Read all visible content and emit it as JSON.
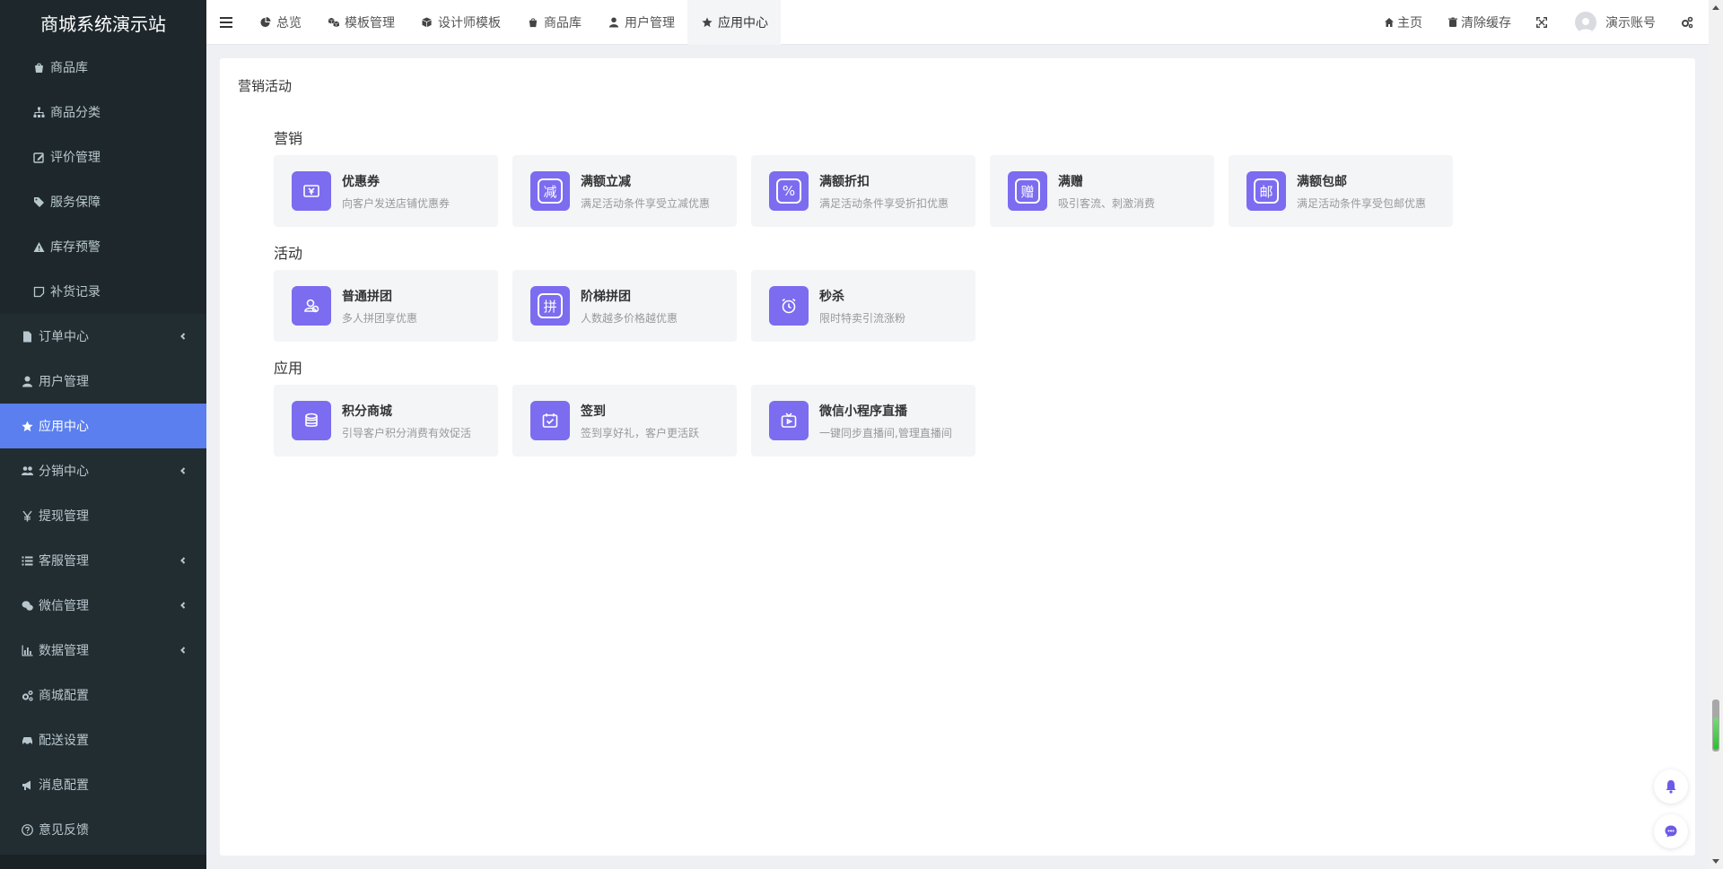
{
  "brand": "商城系统演示站",
  "sidebar": {
    "items": [
      {
        "label": "商品库",
        "icon": "bag-icon",
        "sub": true
      },
      {
        "label": "商品分类",
        "icon": "sitemap-icon",
        "sub": true
      },
      {
        "label": "评价管理",
        "icon": "edit-icon",
        "sub": true
      },
      {
        "label": "服务保障",
        "icon": "tags-icon",
        "sub": true
      },
      {
        "label": "库存预警",
        "icon": "warning-icon",
        "sub": true
      },
      {
        "label": "补货记录",
        "icon": "note-icon",
        "sub": true
      },
      {
        "label": "订单中心",
        "icon": "file-icon",
        "caret": true
      },
      {
        "label": "用户管理",
        "icon": "user-icon"
      },
      {
        "label": "应用中心",
        "icon": "star-icon",
        "active": true
      },
      {
        "label": "分销中心",
        "icon": "users-icon",
        "caret": true
      },
      {
        "label": "提现管理",
        "icon": "yen-icon"
      },
      {
        "label": "客服管理",
        "icon": "list-icon",
        "caret": true
      },
      {
        "label": "微信管理",
        "icon": "wechat-icon",
        "caret": true
      },
      {
        "label": "数据管理",
        "icon": "chart-icon",
        "caret": true
      },
      {
        "label": "商城配置",
        "icon": "cogs-icon"
      },
      {
        "label": "配送设置",
        "icon": "car-icon"
      },
      {
        "label": "消息配置",
        "icon": "bullhorn-icon"
      },
      {
        "label": "意见反馈",
        "icon": "question-icon"
      }
    ]
  },
  "header": {
    "tabs": [
      {
        "label": "总览",
        "icon": "pie-icon"
      },
      {
        "label": "模板管理",
        "icon": "cubes-icon"
      },
      {
        "label": "设计师模板",
        "icon": "cube-icon"
      },
      {
        "label": "商品库",
        "icon": "bag-icon"
      },
      {
        "label": "用户管理",
        "icon": "user-icon"
      },
      {
        "label": "应用中心",
        "icon": "star-icon",
        "active": true
      }
    ],
    "home_label": "主页",
    "clear_cache_label": "清除缓存",
    "account_label": "演示账号"
  },
  "main": {
    "title": "营销活动",
    "sections": [
      {
        "title": "营销",
        "cards": [
          {
            "title": "优惠券",
            "desc": "向客户发送店铺优惠券",
            "icon": "coupon-icon",
            "glyph": ""
          },
          {
            "title": "满额立减",
            "desc": "满足活动条件享受立减优惠",
            "icon": "reduce-icon",
            "glyph": "减"
          },
          {
            "title": "满额折扣",
            "desc": "满足活动条件享受折扣优惠",
            "icon": "percent-icon",
            "glyph": "%"
          },
          {
            "title": "满赠",
            "desc": "吸引客流、刺激消费",
            "icon": "gift-icon",
            "glyph": "赠"
          },
          {
            "title": "满额包邮",
            "desc": "满足活动条件享受包邮优惠",
            "icon": "post-icon",
            "glyph": "邮"
          }
        ]
      },
      {
        "title": "活动",
        "cards": [
          {
            "title": "普通拼团",
            "desc": "多人拼团享优惠",
            "icon": "group-icon",
            "glyph": ""
          },
          {
            "title": "阶梯拼团",
            "desc": "人数越多价格越优惠",
            "icon": "ladder-group-icon",
            "glyph": "拼"
          },
          {
            "title": "秒杀",
            "desc": "限时特卖引流涨粉",
            "icon": "alarm-clock-icon",
            "glyph": ""
          }
        ]
      },
      {
        "title": "应用",
        "cards": [
          {
            "title": "积分商城",
            "desc": "引导客户积分消费有效促活",
            "icon": "points-icon",
            "glyph": ""
          },
          {
            "title": "签到",
            "desc": "签到享好礼，客户更活跃",
            "icon": "checkin-icon",
            "glyph": ""
          },
          {
            "title": "微信小程序直播",
            "desc": "一键同步直播间,管理直播间",
            "icon": "live-icon",
            "glyph": ""
          }
        ]
      }
    ]
  },
  "colors": {
    "accent": "#7b6cf0",
    "sidebar_bg": "#222d32",
    "sidebar_active": "#5b7fee"
  }
}
